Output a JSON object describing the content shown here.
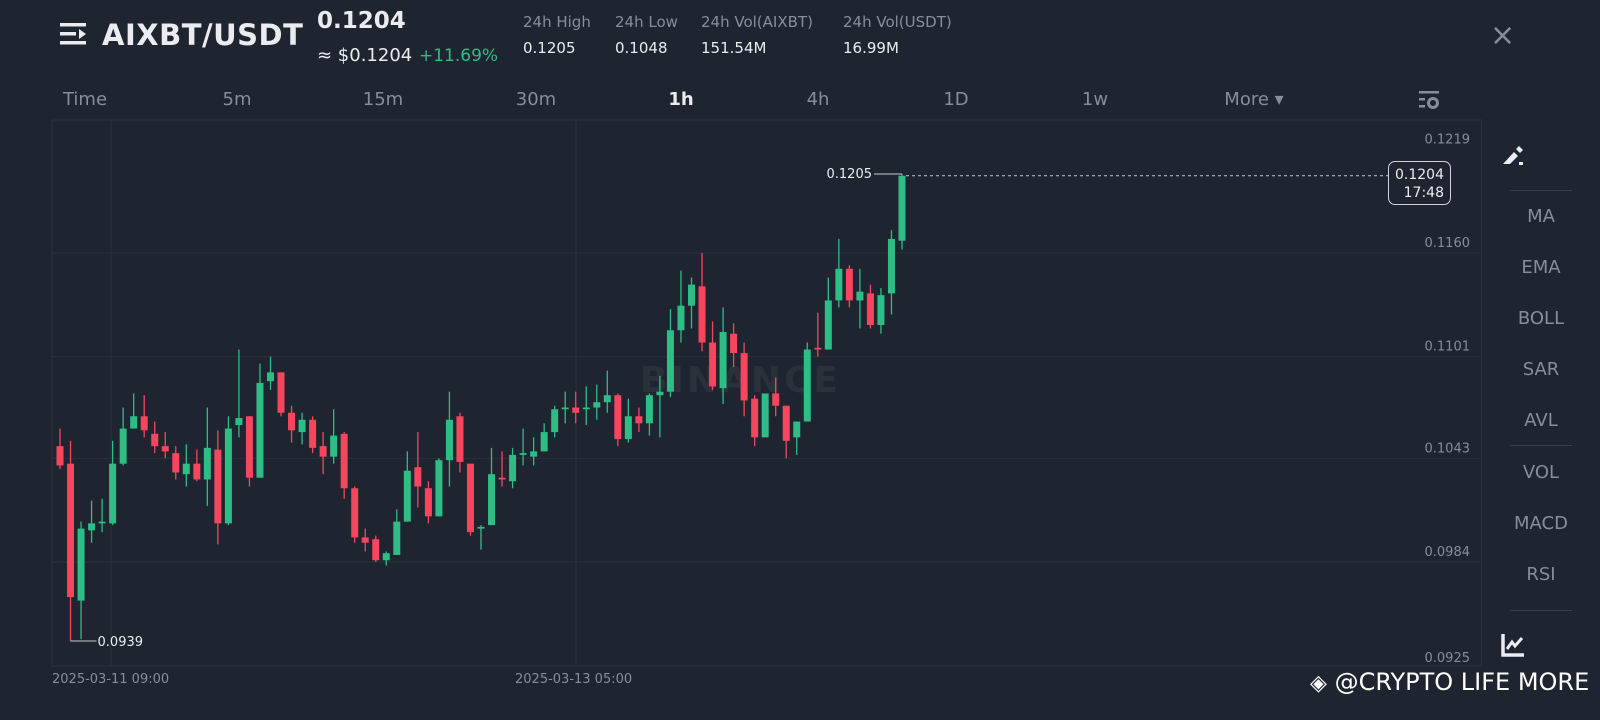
{
  "header": {
    "pair": "AIXBT/USDT",
    "last_price": "0.1204",
    "usd_price": "≈ $0.1204",
    "change": "+11.69%",
    "stats": [
      {
        "label": "24h High",
        "value": "0.1205"
      },
      {
        "label": "24h Low",
        "value": "0.1048"
      },
      {
        "label": "24h Vol(AIXBT)",
        "value": "151.54M"
      },
      {
        "label": "24h Vol(USDT)",
        "value": "16.99M"
      }
    ],
    "close_icon": "×"
  },
  "tabs": [
    {
      "label": "Time"
    },
    {
      "label": "5m"
    },
    {
      "label": "15m"
    },
    {
      "label": "30m"
    },
    {
      "label": "1h",
      "active": true
    },
    {
      "label": "4h"
    },
    {
      "label": "1D"
    },
    {
      "label": "1w"
    },
    {
      "label": "More ▾"
    }
  ],
  "sidebar": {
    "indicators": [
      "MA",
      "EMA",
      "BOLL",
      "SAR",
      "AVL",
      "VOL",
      "MACD",
      "RSI"
    ]
  },
  "watermark": "BINANCE",
  "credit": "@CRYPTO LIFE MORE",
  "colors": {
    "up": "#2ebd85",
    "down": "#f6465d",
    "bg": "#1f2530",
    "grid": "#2b313a"
  },
  "chart_data": {
    "type": "candlestick",
    "interval": "1h",
    "y_ticks": [
      "0.1219",
      "0.1160",
      "0.1101",
      "0.1043",
      "0.0984",
      "0.0925"
    ],
    "x_ticks": [
      "2025-03-11 09:00",
      "2025-03-13 05:00"
    ],
    "max_label": "0.1205",
    "min_label": "0.0939",
    "current_price": "0.1204",
    "countdown": "17:48",
    "ohlc": [
      [
        0.105,
        0.106,
        0.1037,
        0.1039
      ],
      [
        0.104,
        0.1053,
        0.0939,
        0.0964
      ],
      [
        0.0962,
        0.1007,
        0.094,
        0.1003
      ],
      [
        0.1002,
        0.1019,
        0.0995,
        0.1006
      ],
      [
        0.1006,
        0.102,
        0.1001,
        0.1007
      ],
      [
        0.1006,
        0.1053,
        0.1005,
        0.104
      ],
      [
        0.104,
        0.1072,
        0.1039,
        0.106
      ],
      [
        0.106,
        0.108,
        0.106,
        0.1067
      ],
      [
        0.1067,
        0.1079,
        0.1055,
        0.1059
      ],
      [
        0.1057,
        0.1064,
        0.1046,
        0.105
      ],
      [
        0.105,
        0.1058,
        0.1043,
        0.1047
      ],
      [
        0.1046,
        0.105,
        0.1031,
        0.1035
      ],
      [
        0.1034,
        0.1051,
        0.1027,
        0.104
      ],
      [
        0.104,
        0.1048,
        0.103,
        0.1031
      ],
      [
        0.1031,
        0.1072,
        0.1016,
        0.1049
      ],
      [
        0.1048,
        0.1059,
        0.0994,
        0.1006
      ],
      [
        0.1006,
        0.1067,
        0.1005,
        0.106
      ],
      [
        0.1062,
        0.1105,
        0.1055,
        0.1066
      ],
      [
        0.1067,
        0.1067,
        0.1027,
        0.1032
      ],
      [
        0.1032,
        0.1097,
        0.1032,
        0.1086
      ],
      [
        0.1087,
        0.1101,
        0.1082,
        0.1092
      ],
      [
        0.1092,
        0.1092,
        0.1067,
        0.1069
      ],
      [
        0.1069,
        0.1073,
        0.1052,
        0.1059
      ],
      [
        0.1058,
        0.1069,
        0.1051,
        0.1065
      ],
      [
        0.1065,
        0.1067,
        0.1046,
        0.1049
      ],
      [
        0.105,
        0.1058,
        0.1034,
        0.1044
      ],
      [
        0.1044,
        0.1071,
        0.104,
        0.1056
      ],
      [
        0.1057,
        0.1058,
        0.102,
        0.1026
      ],
      [
        0.1026,
        0.1027,
        0.0995,
        0.0998
      ],
      [
        0.0998,
        0.1003,
        0.099,
        0.0995
      ],
      [
        0.0997,
        0.0999,
        0.0984,
        0.0985
      ],
      [
        0.0985,
        0.099,
        0.0982,
        0.0989
      ],
      [
        0.0988,
        0.1014,
        0.0988,
        0.1007
      ],
      [
        0.1007,
        0.1047,
        0.1007,
        0.1036
      ],
      [
        0.1038,
        0.1058,
        0.1015,
        0.1027
      ],
      [
        0.1026,
        0.103,
        0.1006,
        0.101
      ],
      [
        0.101,
        0.1043,
        0.101,
        0.1042
      ],
      [
        0.1042,
        0.1081,
        0.1027,
        0.1065
      ],
      [
        0.1067,
        0.1069,
        0.1035,
        0.1041
      ],
      [
        0.104,
        0.104,
        0.0999,
        0.1001
      ],
      [
        0.1003,
        0.1005,
        0.0991,
        0.1004
      ],
      [
        0.1005,
        0.1049,
        0.1005,
        0.1034
      ],
      [
        0.1032,
        0.1047,
        0.1027,
        0.1031
      ],
      [
        0.103,
        0.1049,
        0.1026,
        0.1045
      ],
      [
        0.1045,
        0.106,
        0.1039,
        0.1046
      ],
      [
        0.1044,
        0.1055,
        0.1039,
        0.1047
      ],
      [
        0.1047,
        0.1063,
        0.1047,
        0.1058
      ],
      [
        0.1058,
        0.1073,
        0.1055,
        0.1071
      ],
      [
        0.1071,
        0.1081,
        0.1063,
        0.1072
      ],
      [
        0.1072,
        0.1081,
        0.1063,
        0.1069
      ],
      [
        0.1071,
        0.1084,
        0.1062,
        0.1072
      ],
      [
        0.1072,
        0.1085,
        0.1065,
        0.1075
      ],
      [
        0.1075,
        0.1093,
        0.1069,
        0.1079
      ],
      [
        0.1079,
        0.108,
        0.105,
        0.1054
      ],
      [
        0.1054,
        0.1077,
        0.1052,
        0.1067
      ],
      [
        0.1067,
        0.1072,
        0.1058,
        0.1063
      ],
      [
        0.1063,
        0.108,
        0.1056,
        0.1079
      ],
      [
        0.1079,
        0.109,
        0.1055,
        0.1081
      ],
      [
        0.1081,
        0.1128,
        0.1078,
        0.1116
      ],
      [
        0.1116,
        0.115,
        0.1109,
        0.113
      ],
      [
        0.113,
        0.1146,
        0.1117,
        0.1142
      ],
      [
        0.1141,
        0.116,
        0.1104,
        0.1109
      ],
      [
        0.1109,
        0.1121,
        0.1082,
        0.1084
      ],
      [
        0.1083,
        0.1129,
        0.1074,
        0.1115
      ],
      [
        0.1114,
        0.112,
        0.1095,
        0.1103
      ],
      [
        0.1103,
        0.1109,
        0.1067,
        0.1076
      ],
      [
        0.1077,
        0.1079,
        0.105,
        0.1055
      ],
      [
        0.1055,
        0.108,
        0.1055,
        0.108
      ],
      [
        0.108,
        0.1089,
        0.1067,
        0.1073
      ],
      [
        0.1073,
        0.1073,
        0.1043,
        0.1053
      ],
      [
        0.1055,
        0.1064,
        0.1045,
        0.1064
      ],
      [
        0.1064,
        0.1109,
        0.1064,
        0.1105
      ],
      [
        0.1106,
        0.1126,
        0.1101,
        0.1105
      ],
      [
        0.1105,
        0.1146,
        0.1105,
        0.1133
      ],
      [
        0.1133,
        0.1168,
        0.1129,
        0.1151
      ],
      [
        0.1151,
        0.1153,
        0.1129,
        0.1133
      ],
      [
        0.1133,
        0.1151,
        0.1117,
        0.1138
      ],
      [
        0.1137,
        0.1142,
        0.1117,
        0.1119
      ],
      [
        0.1119,
        0.114,
        0.1114,
        0.1136
      ],
      [
        0.1137,
        0.1173,
        0.1125,
        0.1168
      ],
      [
        0.1167,
        0.1205,
        0.1162,
        0.1204
      ]
    ]
  }
}
